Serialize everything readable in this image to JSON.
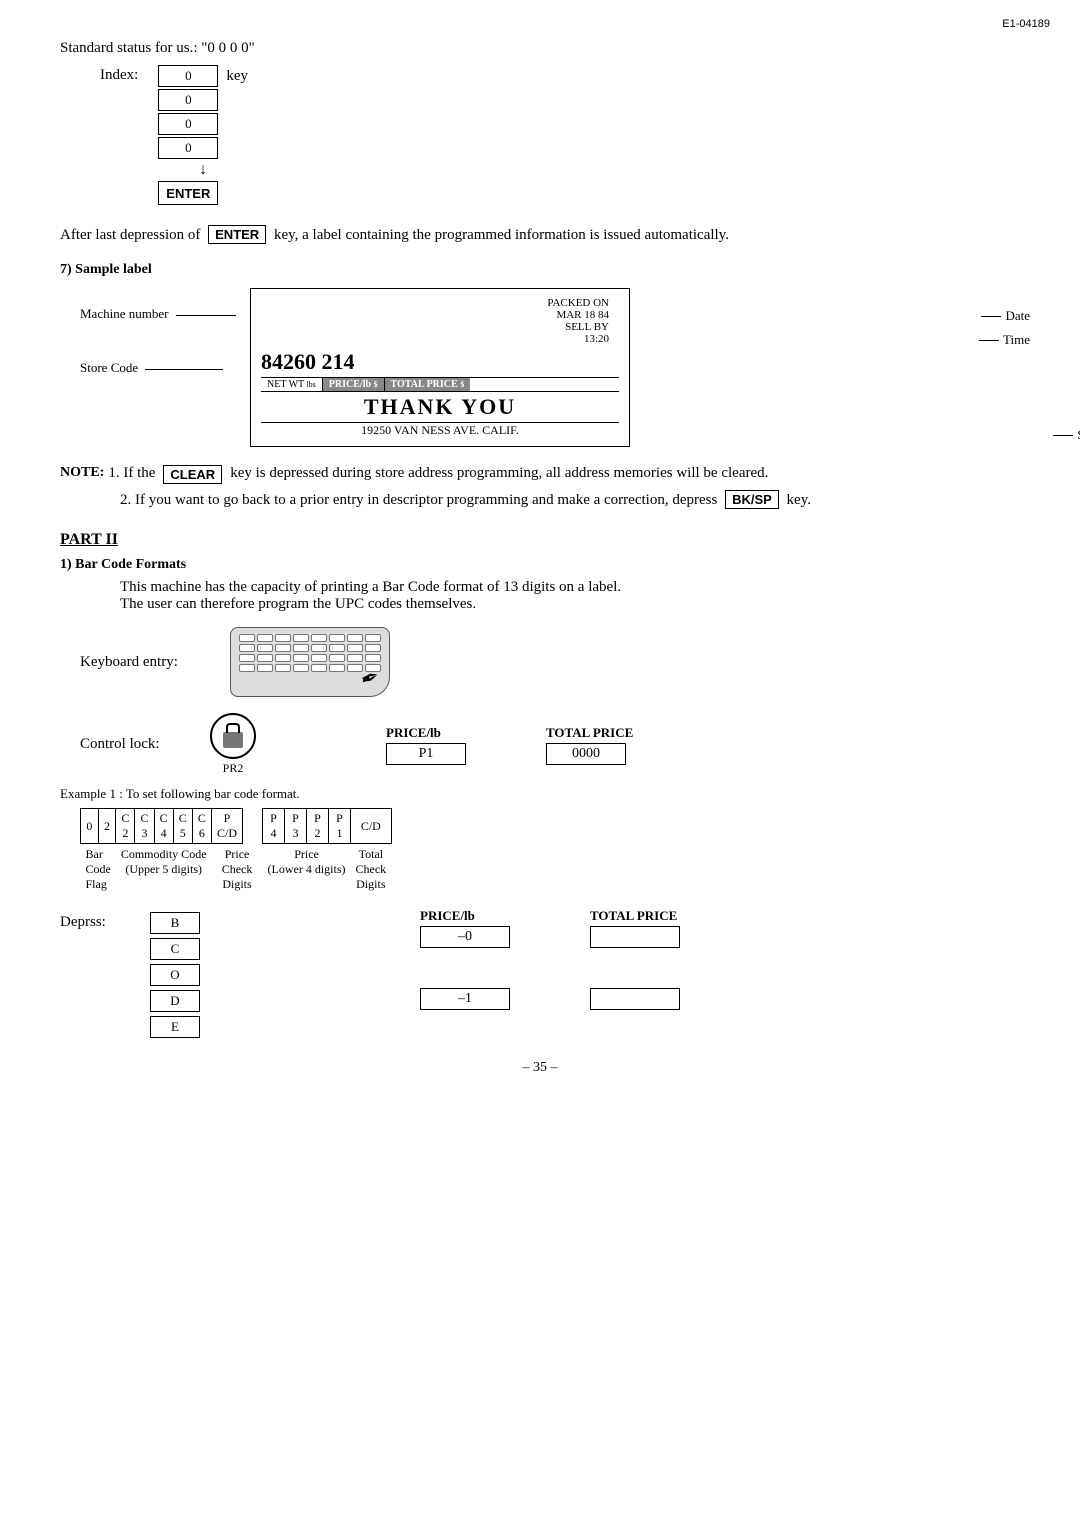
{
  "page_id": "E1-04189",
  "page_number": "– 35 –",
  "standard_status": {
    "label": "Standard status for us.: \"0 0 0 0\"",
    "index_label": "Index:",
    "key_label": "key",
    "index_values": [
      "0",
      "0",
      "0",
      "0"
    ],
    "enter_key": "ENTER",
    "after_text": "After last depression of",
    "enter_key2": "ENTER",
    "after_text2": "key, a label containing the programmed information is issued automatically."
  },
  "sample_label": {
    "heading": "7)  Sample label",
    "machine_number_label": "Machine number",
    "packed_on": "PACKED  ON",
    "date_val": "MAR  18  84",
    "sell_by": "SELL   BY",
    "time_val": "13:20",
    "date_label": "Date",
    "time_label": "Time",
    "store_code_label": "Store Code",
    "store_code_val": "84260   214",
    "net_wt": "NET WT",
    "price_lb": "PRICE/lb",
    "total_price": "TOTAL PRICE",
    "thank_you": "THANK YOU",
    "address": "19250  VAN  NESS  AVE.  CALIF.",
    "store_address_label": "Store Address"
  },
  "notes": {
    "note_label": "NOTE:",
    "note1": "1.  If the",
    "clear_key": "CLEAR",
    "note1b": "key is depressed during store address programming, all address memories will be cleared.",
    "note2": "2.  If you want to go back to a prior entry in descriptor programming and make a correction, depress",
    "bksp_key": "BK/SP",
    "note2b": "key."
  },
  "part2": {
    "heading": "PART II",
    "section1_heading": "1)  Bar Code Formats",
    "section1_text1": "This machine has the capacity of printing a Bar Code format of 13 digits on a label.",
    "section1_text2": "The user can therefore program the UPC codes themselves.",
    "keyboard_label": "Keyboard entry:",
    "control_lock_label": "Control lock:",
    "pr2_label": "PR2",
    "price_lb_label": "PRICE/lb",
    "p1_val": "P1",
    "total_price_label": "TOTAL PRICE",
    "total_price_val": "0000",
    "example_label": "Example 1 : To set following bar code format.",
    "barcode_cols": [
      "0",
      "2",
      "C\n2",
      "C\n3",
      "C\n4",
      "C\n5",
      "C\n6",
      "P\nC/D"
    ],
    "barcode_cols2": [
      "P\n4",
      "P\n3",
      "P\n2",
      "P\n1",
      "C/D"
    ],
    "row_labels": [
      "Bar\nCode\nFlag",
      "Commodity Code\n(Upper 5 digits)",
      "Price\nCheck\nDigits",
      "Price\n(Lower 4 digits)",
      "Total\nCheck\nDigits"
    ],
    "deprss_label": "Deprss:",
    "deprss_boxes": [
      "B",
      "C",
      "O",
      "D",
      "E"
    ],
    "price_lb_label2": "PRICE/lb",
    "price_lb_val2": "–0",
    "total_price_label2": "TOTAL PRICE",
    "total_price_val2": "",
    "price_lb_val3": "–1",
    "total_price_val3": ""
  }
}
